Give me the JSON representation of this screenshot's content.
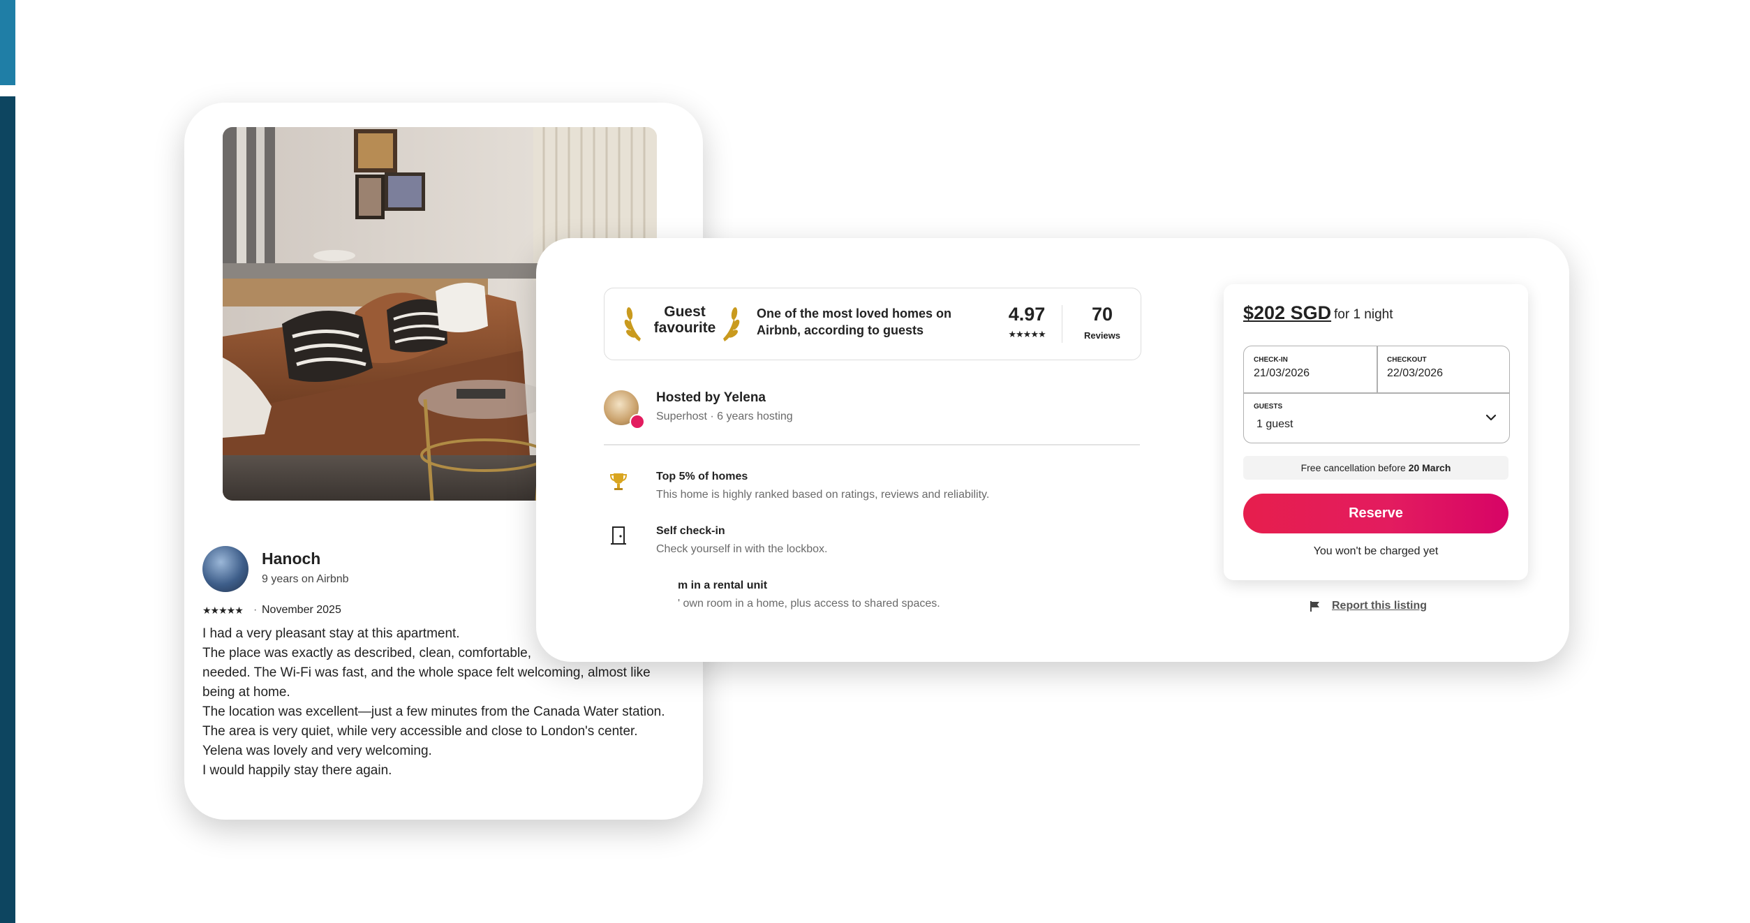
{
  "review": {
    "reviewer_name": "Hanoch",
    "reviewer_meta": "9 years on Airbnb",
    "stars": "★★★★★",
    "rating": 5,
    "date": "November 2025",
    "separator": "·",
    "lines": [
      "I had a very pleasant stay at this apartment.",
      "The place was exactly as described, clean, comfortable,",
      "needed. The Wi-Fi was fast, and the whole space felt welcoming, almost like",
      "being at home.",
      "The location was excellent—just a few minutes from the Canada Water station.",
      "The area is very quiet, while very accessible and close to London's center.",
      "Yelena was lovely and very welcoming.",
      "I would happily stay there again."
    ]
  },
  "listing": {
    "guest_favourite": {
      "label_line1": "Guest",
      "label_line2": "favourite",
      "description": "One of the most loved homes on Airbnb, according to guests",
      "rating": "4.97",
      "stars": "★★★★★",
      "review_count": "70",
      "review_count_label": "Reviews"
    },
    "host": {
      "title": "Hosted by Yelena",
      "subtitle": "Superhost · 6 years hosting"
    },
    "features": [
      {
        "icon": "trophy-icon",
        "title": "Top 5% of homes",
        "description": "This home is highly ranked based on ratings, reviews and reliability."
      },
      {
        "icon": "door-icon",
        "title": "Self check-in",
        "description": "Check yourself in with the lockbox."
      },
      {
        "icon": "",
        "title": "m in a rental unit",
        "description": "' own room in a home, plus access to shared spaces."
      }
    ]
  },
  "booking": {
    "price": "$202 SGD",
    "price_suffix": "for 1 night",
    "checkin_label": "CHECK-IN",
    "checkin_value": "21/03/2026",
    "checkout_label": "CHECKOUT",
    "checkout_value": "22/03/2026",
    "guests_label": "GUESTS",
    "guests_value": "1 guest",
    "free_cancel_prefix": "Free cancellation before",
    "free_cancel_date": "20 March",
    "reserve_label": "Reserve",
    "no_charge": "You won't be charged yet",
    "report_label": "Report this listing"
  },
  "colors": {
    "accent": "#e31c5f",
    "edge_top": "#1f7ea6",
    "edge_main": "#0d4560"
  }
}
